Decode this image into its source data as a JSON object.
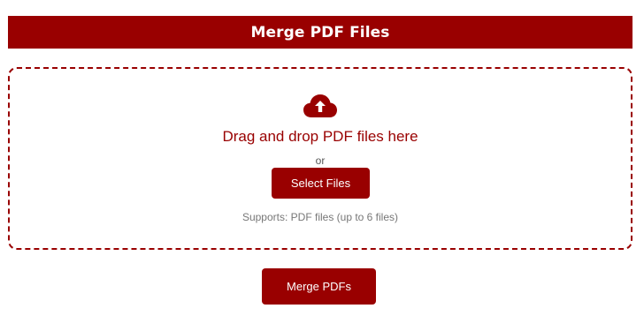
{
  "header": {
    "title": "Merge PDF Files"
  },
  "dropzone": {
    "icon": "cloud-upload-icon",
    "drag_text": "Drag and drop PDF files here",
    "or_text": "or",
    "select_label": "Select Files",
    "supports_text": "Supports: PDF files (up to 6 files)"
  },
  "actions": {
    "merge_label": "Merge PDFs"
  },
  "colors": {
    "accent": "#990000",
    "background": "#ffffff",
    "muted_text": "#777777"
  }
}
